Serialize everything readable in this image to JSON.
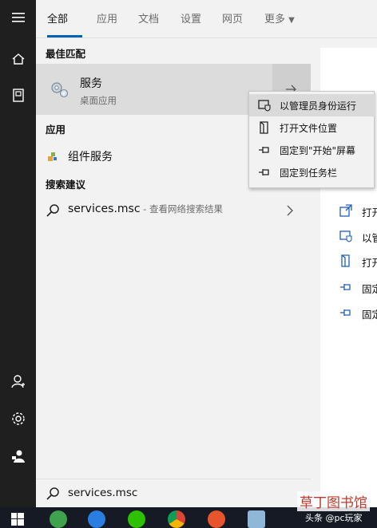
{
  "tabs": [
    "全部",
    "应用",
    "文档",
    "设置",
    "网页",
    "更多"
  ],
  "sections": {
    "best_match": "最佳匹配",
    "apps": "应用",
    "suggestions": "搜索建议"
  },
  "best_match": {
    "title": "服务",
    "subtitle": "桌面应用"
  },
  "apps": [
    {
      "label": "组件服务"
    }
  ],
  "suggestion": {
    "query": "services.msc",
    "suffix": " - 查看网络搜索结果"
  },
  "context_menu": [
    {
      "label": "以管理员身份运行",
      "icon": "shield-run-icon",
      "hover": true
    },
    {
      "label": "打开文件位置",
      "icon": "file-location-icon"
    },
    {
      "label": "固定到\"开始\"屏幕",
      "icon": "pin-icon"
    },
    {
      "label": "固定到任务栏",
      "icon": "pin-icon"
    }
  ],
  "preview_actions": [
    {
      "label": "打开",
      "icon": "open-icon"
    },
    {
      "label": "以管",
      "icon": "shield-run-icon"
    },
    {
      "label": "打开",
      "icon": "file-location-icon"
    },
    {
      "label": "固定",
      "icon": "pin-icon"
    },
    {
      "label": "固定",
      "icon": "pin-icon"
    }
  ],
  "search": {
    "value": "services.msc"
  },
  "watermark": {
    "logo_text": "草丁图书馆",
    "user": "头条 @pc玩家"
  },
  "colors": {
    "accent": "#0063b1",
    "rail": "#1f1f1f",
    "taskbar": "#151a24"
  }
}
